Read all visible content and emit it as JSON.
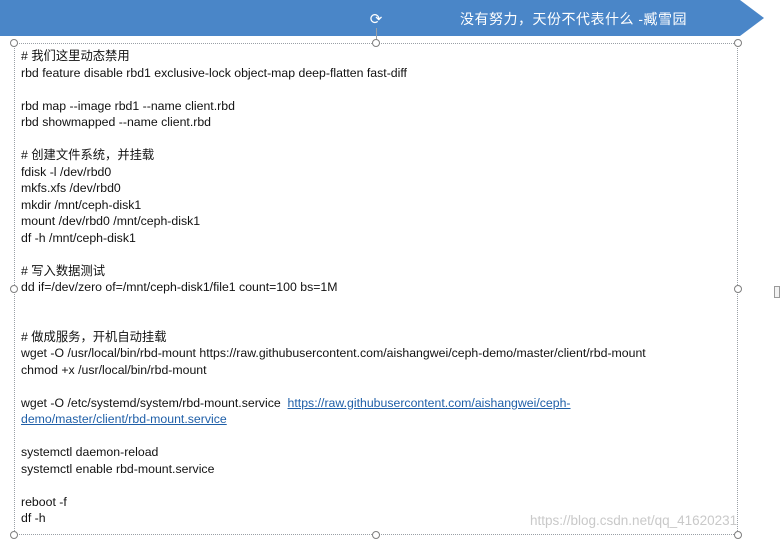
{
  "banner": {
    "title": "没有努力，天份不代表什么  -臧雪园",
    "color": "#4a86c8",
    "rotate_icon": "rotate-icon"
  },
  "lines": [
    "# 我们这里动态禁用",
    "rbd feature disable rbd1  exclusive-lock object-map   deep-flatten fast-diff",
    "",
    "rbd map  --image rbd1  --name  client.rbd",
    "rbd showmapped  --name  client.rbd",
    "",
    "# 创建文件系统，并挂载",
    "fdisk  -l  /dev/rbd0",
    "mkfs.xfs   /dev/rbd0",
    "mkdir  /mnt/ceph-disk1",
    "mount  /dev/rbd0  /mnt/ceph-disk1",
    "df  -h  /mnt/ceph-disk1",
    "",
    "# 写入数据测试",
    "dd if=/dev/zero of=/mnt/ceph-disk1/file1 count=100 bs=1M",
    "",
    "",
    "# 做成服务，开机自动挂载",
    "wget  -O  /usr/local/bin/rbd-mount   https://raw.githubusercontent.com/aishangwei/ceph-demo/master/client/rbd-mount",
    "chmod +x  /usr/local/bin/rbd-mount",
    "",
    "wget -O  /etc/systemd/system/rbd-mount.service",
    "",
    "systemctl daemon-reload",
    "systemctl enable rbd-mount.service",
    "",
    "reboot -f",
    "df -h"
  ],
  "wget_service_link_part1": "https://raw.githubusercontent.com/aishangwei/ceph-",
  "wget_service_link_part2": "demo/master/client/rbd-mount.service",
  "watermark": "https://blog.csdn.net/qq_41620231"
}
